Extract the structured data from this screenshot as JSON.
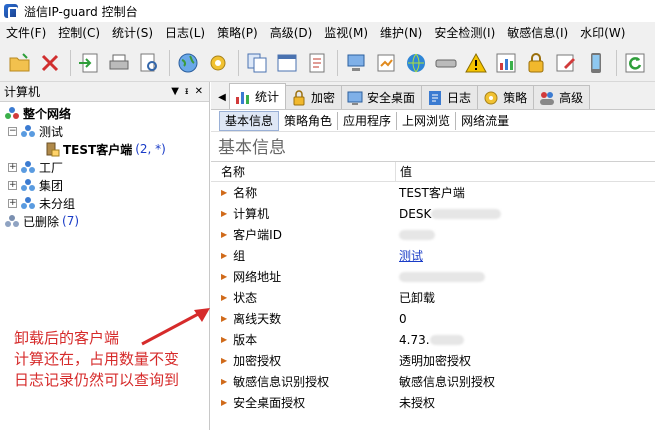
{
  "window": {
    "title": "溢信IP-guard 控制台"
  },
  "menu": [
    "文件(F)",
    "控制(C)",
    "统计(S)",
    "日志(L)",
    "策略(P)",
    "高级(D)",
    "监视(M)",
    "维护(N)",
    "安全检测(I)",
    "敏感信息(I)",
    "水印(W)"
  ],
  "left_panel": {
    "title": "计算机",
    "controls": {
      "dropdown": "▼",
      "pin": "ᵻ",
      "close": "✕"
    },
    "tree": {
      "root": "整个网络",
      "group_test": "测试",
      "client": "TEST客户端",
      "client_count": "(2, *)",
      "group_factory": "工厂",
      "group_corp": "集团",
      "group_ungrouped": "未分组",
      "deleted": "已删除",
      "deleted_count": "(7)"
    }
  },
  "tabs": [
    "统计",
    "加密",
    "安全桌面",
    "日志",
    "策略",
    "高级"
  ],
  "subtabs": [
    "基本信息",
    "策略角色",
    "应用程序",
    "上网浏览",
    "网络流量"
  ],
  "section_title": "基本信息",
  "grid": {
    "header_name": "名称",
    "header_value": "值",
    "rows": [
      {
        "name": "名称",
        "value": "TEST客户端"
      },
      {
        "name": "计算机",
        "value": "DESK"
      },
      {
        "name": "客户端ID",
        "value": ""
      },
      {
        "name": "组",
        "value": "测试"
      },
      {
        "name": "网络地址",
        "value": ""
      },
      {
        "name": "状态",
        "value": "已卸载"
      },
      {
        "name": "离线天数",
        "value": "0"
      },
      {
        "name": "版本",
        "value": "4.73."
      },
      {
        "name": "加密授权",
        "value": "透明加密授权"
      },
      {
        "name": "敏感信息识别授权",
        "value": "敏感信息识别授权"
      },
      {
        "name": "安全桌面授权",
        "value": "未授权"
      }
    ]
  },
  "annotation": {
    "line1": "卸载后的客户端",
    "line2": "计算还在，占用数量不变",
    "line3": "日志记录仍然可以查询到"
  },
  "colors": {
    "annotation": "#d62b2b",
    "link": "#1a3cc7",
    "row_arrow": "#d06a1a"
  }
}
